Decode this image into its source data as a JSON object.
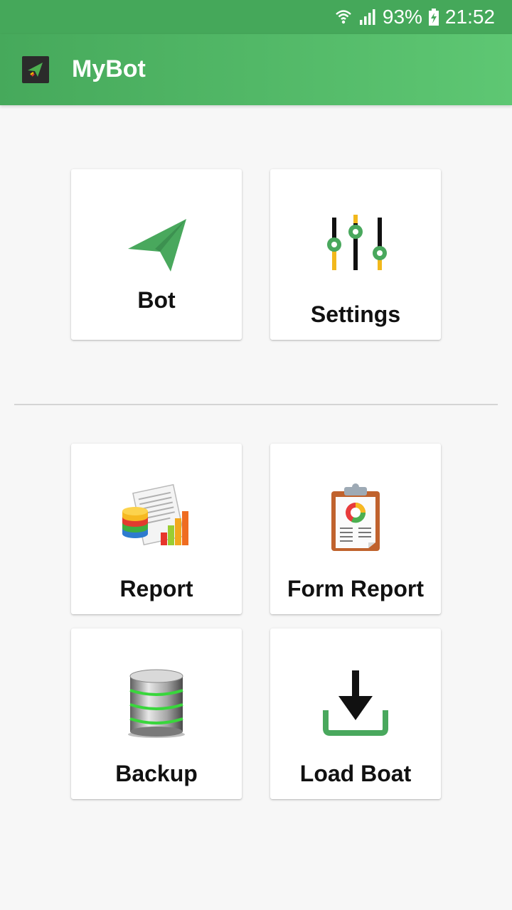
{
  "status_bar": {
    "battery": "93%",
    "time": "21:52",
    "icons": [
      "wifi-icon",
      "signal-icon",
      "battery-charging-icon"
    ]
  },
  "app_bar": {
    "title": "MyBot",
    "logo_icon": "paper-plane-icon",
    "color": "#4caf50"
  },
  "menu": {
    "bot": {
      "label": "Bot",
      "icon": "paper-plane-icon"
    },
    "settings": {
      "label": "Settings",
      "icon": "sliders-icon"
    },
    "report": {
      "label": "Report",
      "icon": "report-chart-icon"
    },
    "form_report": {
      "label": "Form Report",
      "icon": "clipboard-report-icon"
    },
    "backup": {
      "label": "Backup",
      "icon": "database-icon"
    },
    "load_boat": {
      "label": "Load Boat",
      "icon": "download-icon"
    }
  }
}
